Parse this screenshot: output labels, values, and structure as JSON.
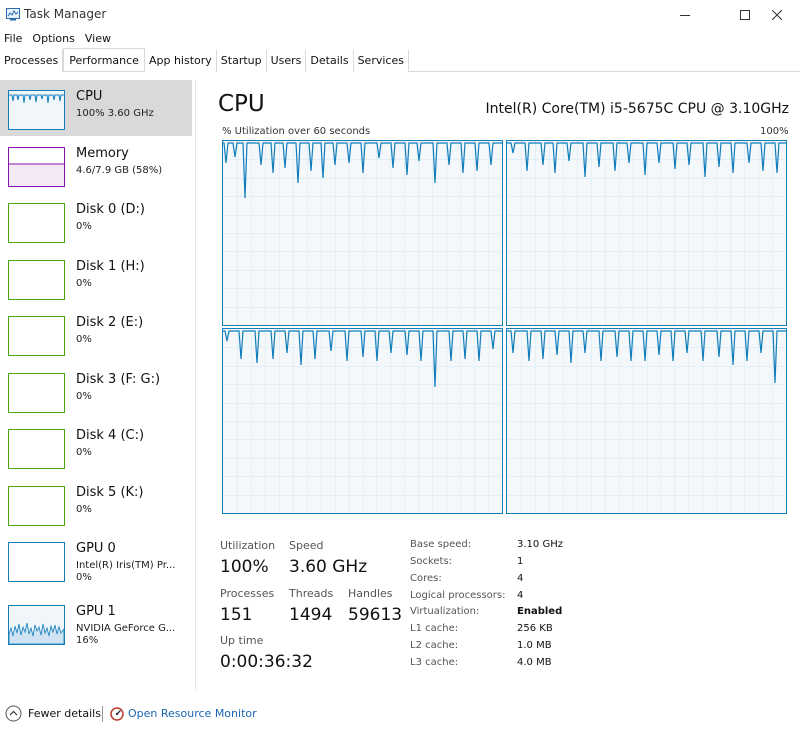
{
  "window": {
    "title": "Task Manager"
  },
  "menu": [
    "File",
    "Options",
    "View"
  ],
  "tabs": [
    "Processes",
    "Performance",
    "App history",
    "Startup",
    "Users",
    "Details",
    "Services"
  ],
  "active_tab": "Performance",
  "sidebar": {
    "items": [
      {
        "title": "CPU",
        "sub": "100% 3.60 GHz",
        "color": "#117dbb"
      },
      {
        "title": "Memory",
        "sub": "4.6/7.9 GB (58%)",
        "color": "#8b12ae"
      },
      {
        "title": "Disk 0 (D:)",
        "sub": "0%",
        "color": "#4da60c"
      },
      {
        "title": "Disk 1 (H:)",
        "sub": "0%",
        "color": "#4da60c"
      },
      {
        "title": "Disk 2 (E:)",
        "sub": "0%",
        "color": "#4da60c"
      },
      {
        "title": "Disk 3 (F: G:)",
        "sub": "0%",
        "color": "#4da60c"
      },
      {
        "title": "Disk 4 (C:)",
        "sub": "0%",
        "color": "#4da60c"
      },
      {
        "title": "Disk 5 (K:)",
        "sub": "0%",
        "color": "#4da60c"
      },
      {
        "title": "GPU 0",
        "sub": "Intel(R) Iris(TM) Pr...",
        "sub2": "0%",
        "color": "#117dbb"
      },
      {
        "title": "GPU 1",
        "sub": "NVIDIA GeForce G...",
        "sub2": "16%",
        "color": "#117dbb"
      }
    ]
  },
  "main": {
    "title": "CPU",
    "model": "Intel(R) Core(TM) i5-5675C CPU @ 3.10GHz",
    "graph_label": "% Utilization over 60 seconds",
    "graph_max": "100%",
    "stats": {
      "utilization_label": "Utilization",
      "utilization": "100%",
      "speed_label": "Speed",
      "speed": "3.60 GHz",
      "processes_label": "Processes",
      "processes": "151",
      "threads_label": "Threads",
      "threads": "1494",
      "handles_label": "Handles",
      "handles": "59613",
      "uptime_label": "Up time",
      "uptime": "0:00:36:32"
    },
    "specs": [
      {
        "key": "Base speed:",
        "value": "3.10 GHz"
      },
      {
        "key": "Sockets:",
        "value": "1"
      },
      {
        "key": "Cores:",
        "value": "4"
      },
      {
        "key": "Logical processors:",
        "value": "4"
      },
      {
        "key": "Virtualization:",
        "value": "Enabled"
      },
      {
        "key": "L1 cache:",
        "value": "256 KB"
      },
      {
        "key": "L2 cache:",
        "value": "1.0 MB"
      },
      {
        "key": "L3 cache:",
        "value": "4.0 MB"
      }
    ]
  },
  "footer": {
    "fewer_details": "Fewer details",
    "open_resource_monitor": "Open Resource Monitor"
  },
  "colors": {
    "cpu_line": "#117dbb",
    "memory": "#8b12ae",
    "disk": "#4da60c",
    "graph_bg": "#f1f6fa",
    "link": "#1a66b3"
  }
}
